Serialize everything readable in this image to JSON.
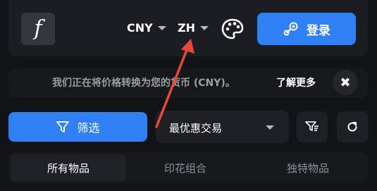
{
  "header": {
    "logo_letter": "f",
    "currency": "CNY",
    "language": "ZH",
    "palette_icon": "palette-icon",
    "login_label": "登录",
    "login_icon": "steam-icon"
  },
  "banner": {
    "message": "我们正在将价格转换为您的货币 (CNY)。",
    "learn_more": "了解更多",
    "close_symbol": "✖"
  },
  "toolbar": {
    "filter_label": "筛选",
    "filter_icon": "funnel-icon",
    "sort_selected": "最优惠交易",
    "sort_direction_icon": "sort-filter-icon",
    "refresh_icon": "refresh-icon"
  },
  "tabs": [
    {
      "label": "所有物品",
      "active": true
    },
    {
      "label": "印花组合",
      "active": false
    },
    {
      "label": "独特物品",
      "active": false
    }
  ],
  "colors": {
    "accent": "#2f80f5",
    "annotation_arrow": "#e8483a",
    "background": "#121317"
  }
}
